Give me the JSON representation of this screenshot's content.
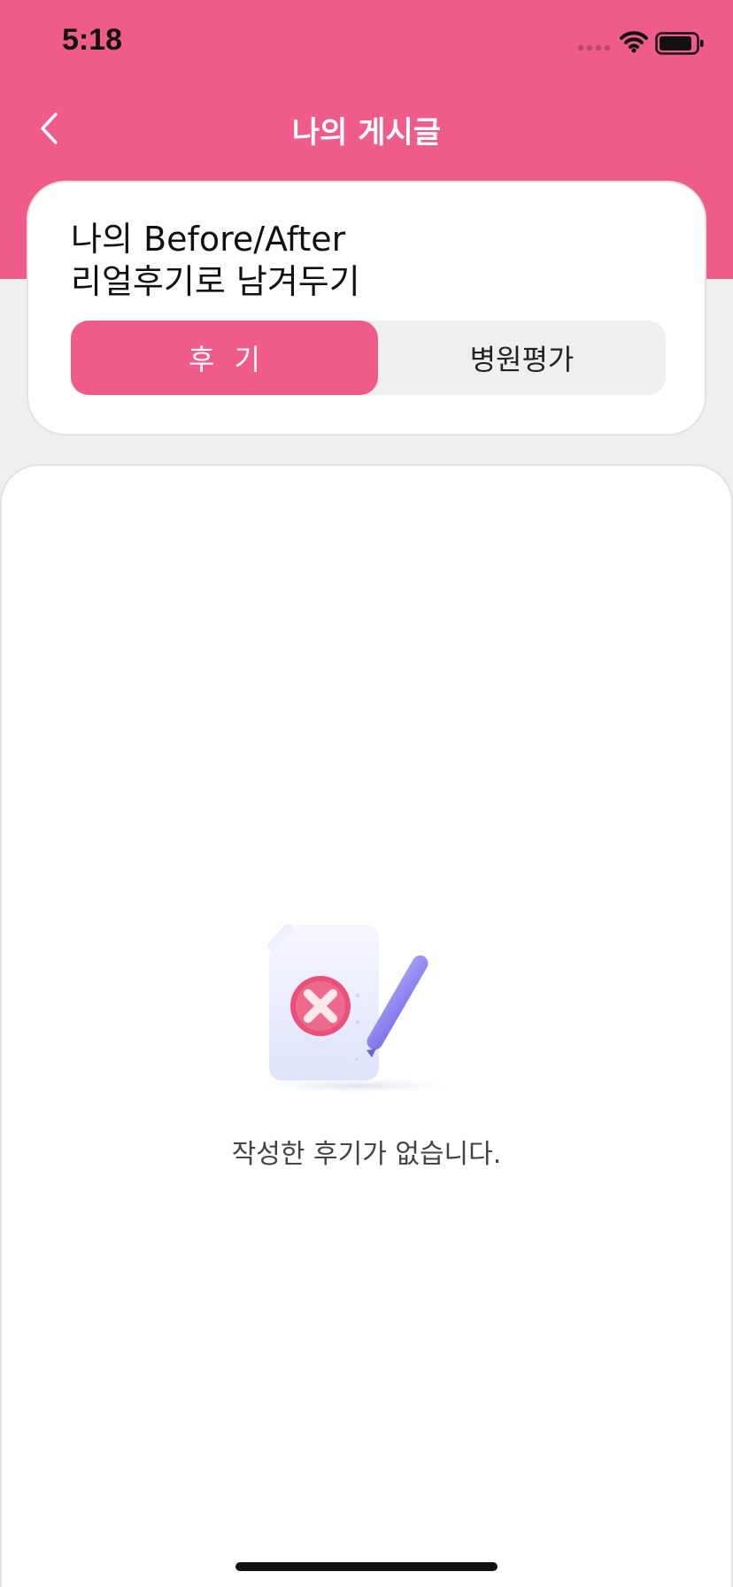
{
  "status_bar": {
    "time": "5:18"
  },
  "nav": {
    "title": "나의 게시글",
    "back_icon": "chevron-left-icon"
  },
  "intro": {
    "title": "나의 Before/After\n리얼후기로 남겨두기",
    "tabs": [
      {
        "label": "후기",
        "active": true
      },
      {
        "label": "병원평가",
        "active": false
      }
    ]
  },
  "empty_state": {
    "icon": "document-error-icon",
    "message": "작성한 후기가 없습니다."
  },
  "colors": {
    "accent": "#ef5c8a",
    "background": "#efefef",
    "error": "#e9507a",
    "pencil": "#8f86f2"
  }
}
